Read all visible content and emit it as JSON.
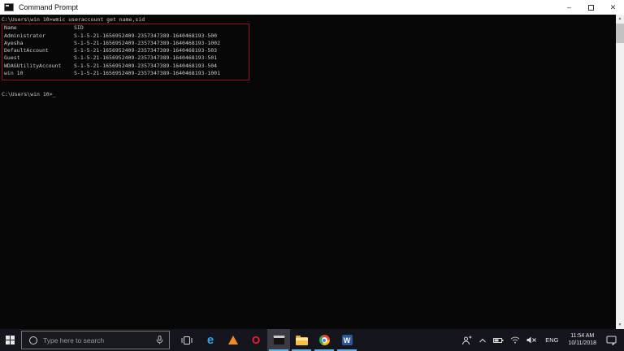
{
  "window": {
    "title": "Command Prompt",
    "controls": {
      "minimize": "–",
      "close": "✕"
    }
  },
  "console": {
    "prompt": "C:\\Users\\win 10>",
    "command": "wmic useraccount get name,sid",
    "cursor": "_",
    "table": {
      "headers": {
        "name": "Name",
        "sid": "SID"
      },
      "rows": [
        {
          "name": "Administrator",
          "sid": "S-1-5-21-1656952409-2357347389-1640468193-500"
        },
        {
          "name": "Ayesha",
          "sid": "S-1-5-21-1656952409-2357347389-1640468193-1002"
        },
        {
          "name": "DefaultAccount",
          "sid": "S-1-5-21-1656952409-2357347389-1640468193-503"
        },
        {
          "name": "Guest",
          "sid": "S-1-5-21-1656952409-2357347389-1640468193-501"
        },
        {
          "name": "WDAGUtilityAccount",
          "sid": "S-1-5-21-1656952409-2357347389-1640468193-504"
        },
        {
          "name": "win 10",
          "sid": "S-1-5-21-1656952409-2357347389-1640468193-1001"
        }
      ]
    },
    "colors": {
      "background": "#070707",
      "text": "#cccccc",
      "annotation_box": "#8b1a1a"
    }
  },
  "taskbar": {
    "search": {
      "placeholder": "Type here to search"
    },
    "app_glyphs": {
      "edge": "e",
      "opera": "O",
      "word": "W"
    },
    "running_apps": [
      "command-prompt",
      "file-explorer",
      "chrome",
      "word"
    ],
    "active_app": "command-prompt",
    "tray": {
      "language": "ENG",
      "time": "11:54 AM",
      "date": "10/11/2018"
    },
    "colors": {
      "background": "#15151d",
      "running_underline": "#5fb2e8"
    }
  }
}
